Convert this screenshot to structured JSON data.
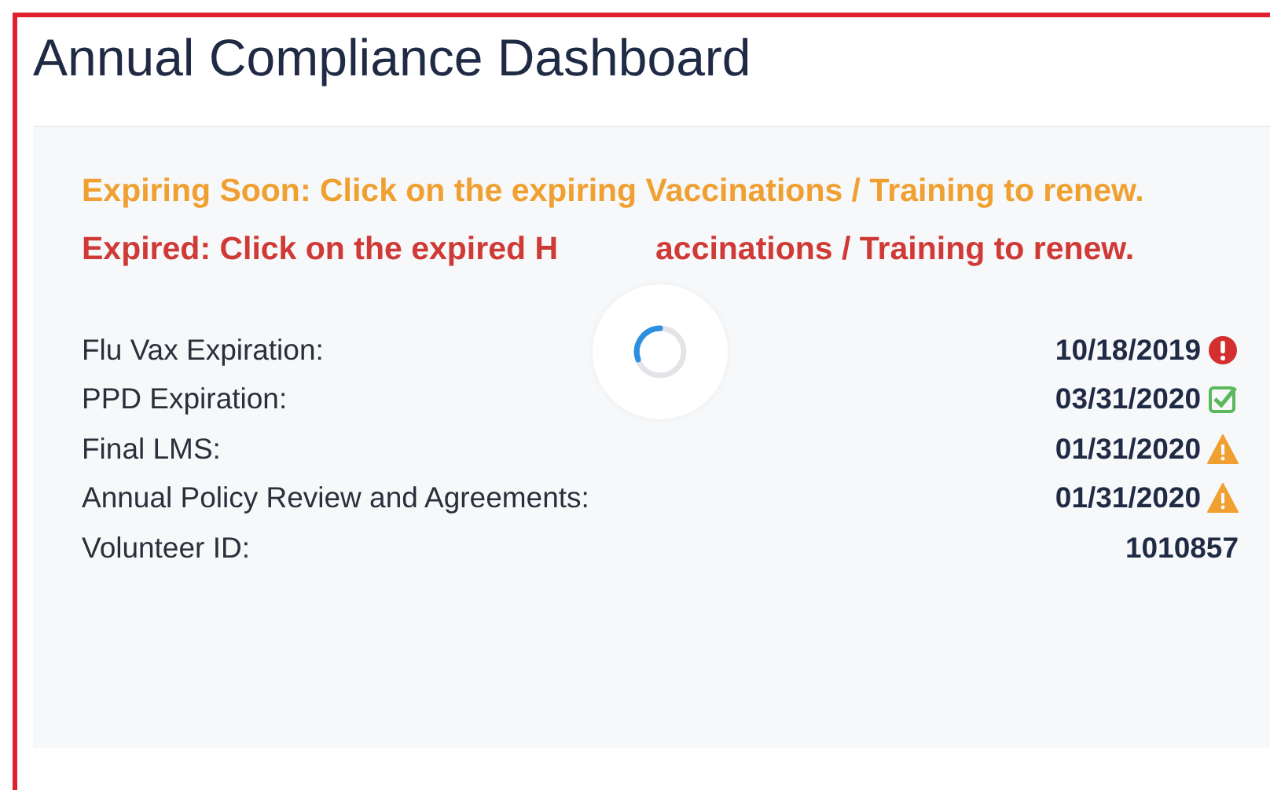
{
  "title": "Annual Compliance Dashboard",
  "notices": [
    {
      "kind": "expiring",
      "before": "Expiring Soon: Click on the expiring Vaccinations / Training to renew."
    },
    {
      "kind": "expired",
      "before": "Expired: Click on the expired H",
      "after": "accinations / Training to renew."
    }
  ],
  "loading": true,
  "rows": [
    {
      "label": "Flu Vax Expiration:",
      "value": "10/18/2019",
      "kind": "expired"
    },
    {
      "label": "PPD Expiration:",
      "value": "03/31/2020",
      "kind": "ok"
    },
    {
      "label": "Final LMS:",
      "value": "01/31/2020",
      "kind": "warning"
    },
    {
      "label": "Annual Policy Review and Agreements:",
      "value": "01/31/2020",
      "kind": "warning"
    },
    {
      "label": "Volunteer ID:",
      "value": "1010857"
    }
  ]
}
